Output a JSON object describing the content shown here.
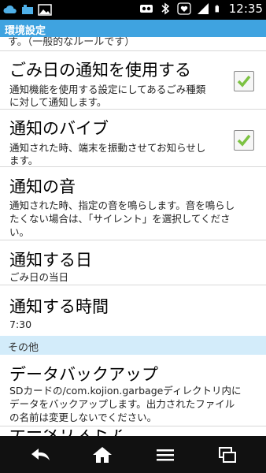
{
  "status_bar": {
    "time": "12:35",
    "left_icons": [
      "cloud-icon",
      "phone-icon",
      "image-icon"
    ],
    "right_icons": [
      "voicemail-icon",
      "bluetooth-icon",
      "heart-icon",
      "signal-icon",
      "battery-icon"
    ]
  },
  "title_bar": {
    "title": "環境設定"
  },
  "cut_top_text": "す。（一般的なルールです）",
  "preferences": [
    {
      "title": "ごみ日の通知を使用する",
      "summary": [
        "通知機能を使用する設定にしてあるごみ種類",
        "に対して通知します。"
      ],
      "checked": true
    },
    {
      "title": "通知のバイブ",
      "summary": [
        "通知された時、端末を振動させてお知らせし",
        "ます。"
      ],
      "checked": true
    },
    {
      "title": "通知の音",
      "summary": [
        "通知された時、指定の音を鳴らします。音を鳴らし",
        "たくない場合は、「サイレント」を選択してくださ",
        "い。"
      ]
    },
    {
      "title": "通知する日",
      "summary": [
        "ごみ日の当日"
      ]
    },
    {
      "title": "通知する時間",
      "summary": [
        "7:30"
      ]
    }
  ],
  "section_header": "その他",
  "backup": {
    "title": "データバックアップ",
    "summary": [
      "SDカードの/com.kojion.garbageディレクトリ内に",
      "データをバックアップします。出力されたファイル",
      "の名前は変更しないでください。"
    ]
  },
  "cut_bottom_text": "データリストア",
  "nav_bar": {
    "buttons": [
      "back-icon",
      "home-icon",
      "menu-icon",
      "recent-apps-icon"
    ]
  }
}
